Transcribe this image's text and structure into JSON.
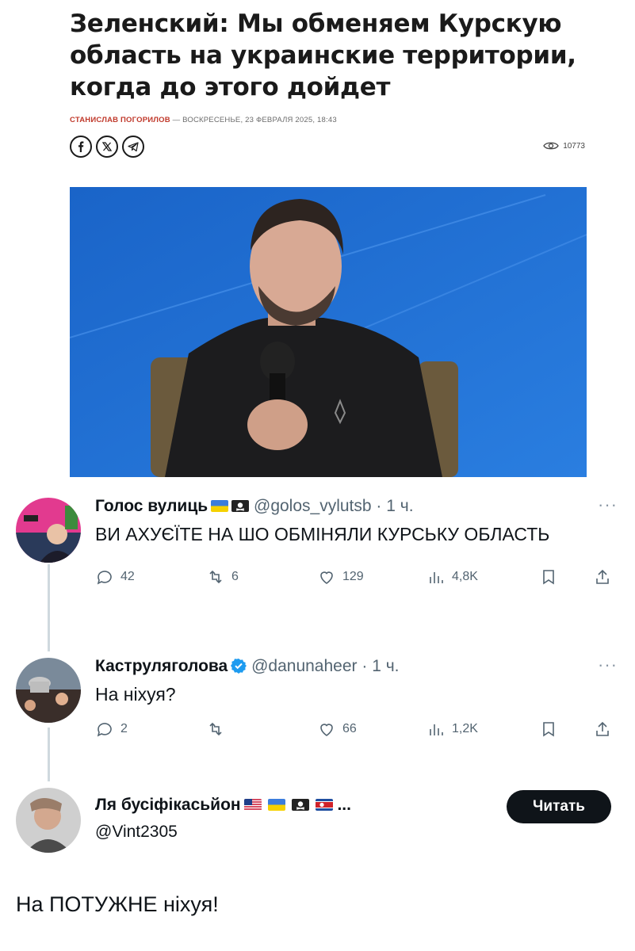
{
  "article": {
    "headline": "Зеленский: Мы обменяем Курскую область на украинские территории, когда до этого дойдет",
    "author": "СТАНИСЛАВ ПОГОРИЛОВ",
    "byline_rest": " — ВОСКРЕСЕНЬЕ, 23 ФЕВРАЛЯ 2025, 18:43",
    "share": [
      "facebook-icon",
      "x-icon",
      "telegram-icon"
    ],
    "views": "10773"
  },
  "tweets": [
    {
      "name": "Голос вулиць",
      "flags": [
        "ukraine-flag",
        "pirate-flag"
      ],
      "handle": "@golos_vylutsb",
      "time": "· 1 ч.",
      "text": "ВИ АХУЄЇТЕ НА ШО ОБМІНЯЛИ КУРСЬКУ ОБЛАСТЬ",
      "replies": "42",
      "retweets": "6",
      "likes": "129",
      "views": "4,8K"
    },
    {
      "name": "Каструляголова",
      "verified": true,
      "handle": "@danunaheer",
      "time": "· 1 ч.",
      "text": "На ніхуя?",
      "replies": "2",
      "retweets": "",
      "likes": "66",
      "views": "1,2K"
    },
    {
      "name": "Ля бусіфікасьйон",
      "flags": [
        "usa-flag",
        "ukraine-flag",
        "pirate-flag",
        "north-korea-flag"
      ],
      "ellipsis": "...",
      "handle": "@Vint2305",
      "follow_label": "Читать",
      "text": "На ПОТУЖНЕ ніхуя!"
    }
  ],
  "colors": {
    "accent": "#1d9bf0",
    "muted": "#536471",
    "line": "#cfd9de",
    "photo_bg": "#1f6fd0"
  }
}
